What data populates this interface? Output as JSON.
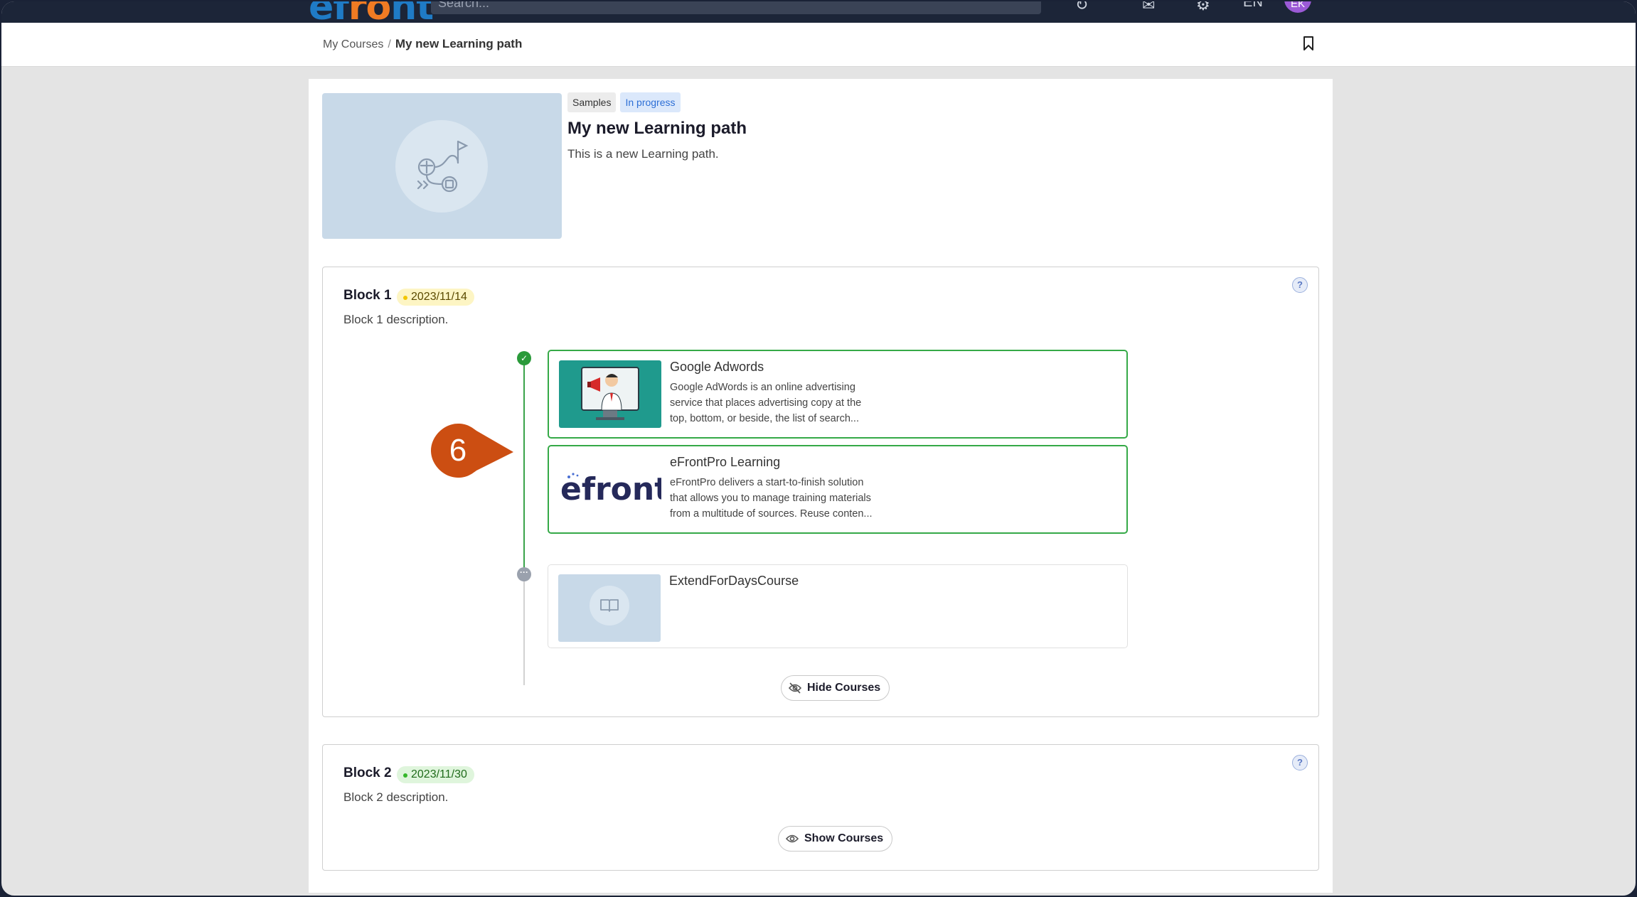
{
  "app": {
    "logo_part1": "ef",
    "logo_part2": "ro",
    "logo_part3": "nt",
    "search_placeholder": "Search...",
    "lang": "EN",
    "avatar_initials": "EK"
  },
  "breadcrumb": {
    "parent": "My Courses",
    "separator": "/",
    "current": "My new Learning path"
  },
  "learning_path": {
    "tag_category": "Samples",
    "tag_status": "In progress",
    "title": "My new Learning path",
    "description": "This is a new Learning path."
  },
  "blocks": [
    {
      "title": "Block 1",
      "date": "2023/11/14",
      "description": "Block 1 description.",
      "toggle_label": "Hide Courses",
      "courses": [
        {
          "title": "Google Adwords",
          "description_lines": [
            "Google AdWords is an online advertising",
            "service that places advertising copy at the",
            "top, bottom, or beside, the list of search..."
          ],
          "status": "completed"
        },
        {
          "title": "eFrontPro Learning",
          "logo_text": "efront",
          "description_lines": [
            "eFrontPro delivers a start-to-finish solution",
            "that allows you to manage training materials",
            "from a multitude of sources. Reuse conten..."
          ],
          "status": "completed"
        },
        {
          "title": "ExtendForDaysCourse",
          "status": "pending"
        }
      ]
    },
    {
      "title": "Block 2",
      "date": "2023/11/30",
      "description": "Block 2 description.",
      "toggle_label": "Show Courses"
    }
  ],
  "callout": {
    "number": "6",
    "color": "#cc4e12"
  },
  "colors": {
    "nav_bg": "#1c2538",
    "accent_blue": "#1f7bc6",
    "accent_orange": "#f07b23",
    "success_green": "#35a947",
    "callout": "#cc4e12"
  }
}
